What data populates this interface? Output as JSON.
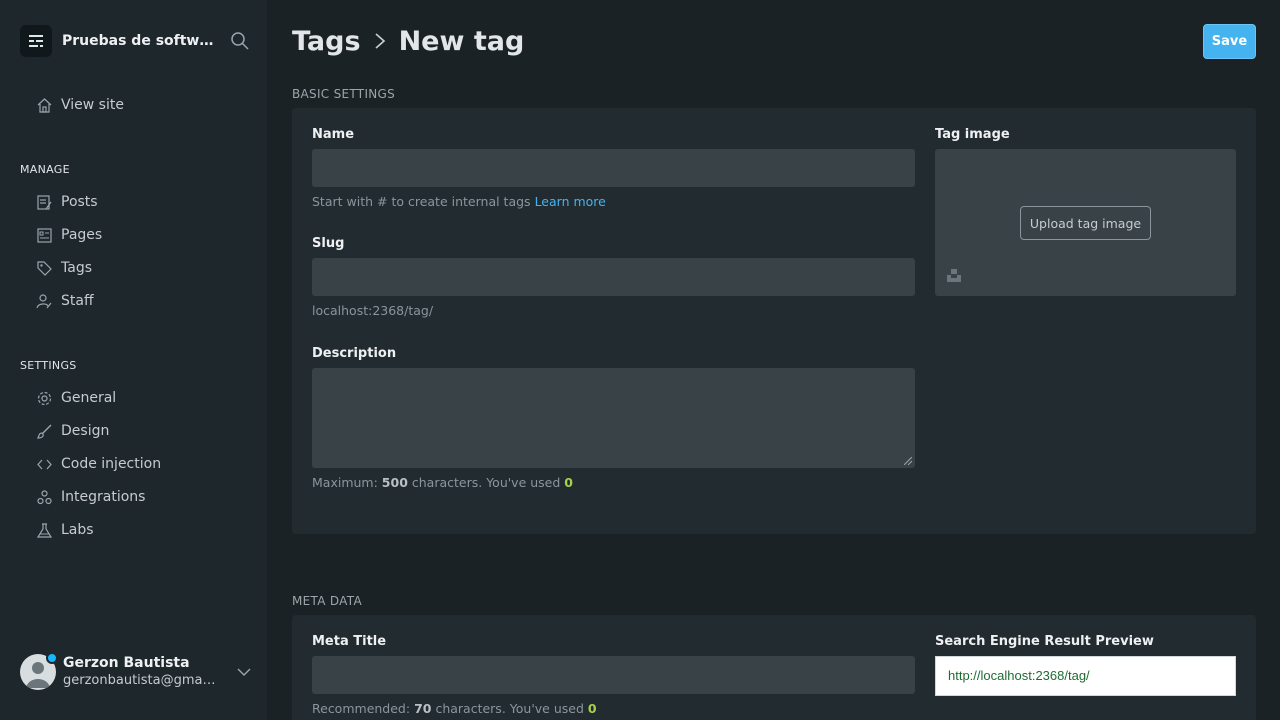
{
  "sidebar": {
    "site_title": "Pruebas de software",
    "view_site": "View site",
    "manage_heading": "MANAGE",
    "manage_items": [
      {
        "label": "Posts",
        "icon": "posts-icon"
      },
      {
        "label": "Pages",
        "icon": "pages-icon"
      },
      {
        "label": "Tags",
        "icon": "tag-icon"
      },
      {
        "label": "Staff",
        "icon": "staff-icon"
      }
    ],
    "settings_heading": "SETTINGS",
    "settings_items": [
      {
        "label": "General",
        "icon": "gear-icon"
      },
      {
        "label": "Design",
        "icon": "brush-icon"
      },
      {
        "label": "Code injection",
        "icon": "code-icon"
      },
      {
        "label": "Integrations",
        "icon": "integrations-icon"
      },
      {
        "label": "Labs",
        "icon": "flask-icon"
      }
    ],
    "user": {
      "name": "Gerzon Bautista",
      "email": "gerzonbautista@gmail.com"
    }
  },
  "header": {
    "breadcrumb_parent": "Tags",
    "breadcrumb_current": "New tag",
    "save_label": "Save"
  },
  "basic": {
    "section_title": "BASIC SETTINGS",
    "name_label": "Name",
    "name_value": "",
    "name_hint": "Start with # to create internal tags",
    "learn_more": "Learn more",
    "slug_label": "Slug",
    "slug_value": "",
    "slug_hint": "localhost:2368/tag/",
    "description_label": "Description",
    "description_value": "",
    "desc_hint_prefix": "Maximum:",
    "desc_max": "500",
    "desc_hint_mid": "characters. You've used",
    "desc_used": "0",
    "tag_image_label": "Tag image",
    "upload_label": "Upload tag image"
  },
  "meta": {
    "section_title": "META DATA",
    "meta_title_label": "Meta Title",
    "meta_title_value": "",
    "hint_prefix": "Recommended:",
    "hint_recommended": "70",
    "hint_mid": "characters. You've used",
    "hint_used": "0",
    "serp_label": "Search Engine Result Preview",
    "serp_url": "http://localhost:2368/tag/"
  },
  "colors": {
    "accent": "#45b3f0",
    "counter_green": "#a6d14a",
    "serp_url_green": "#1f6b34"
  }
}
